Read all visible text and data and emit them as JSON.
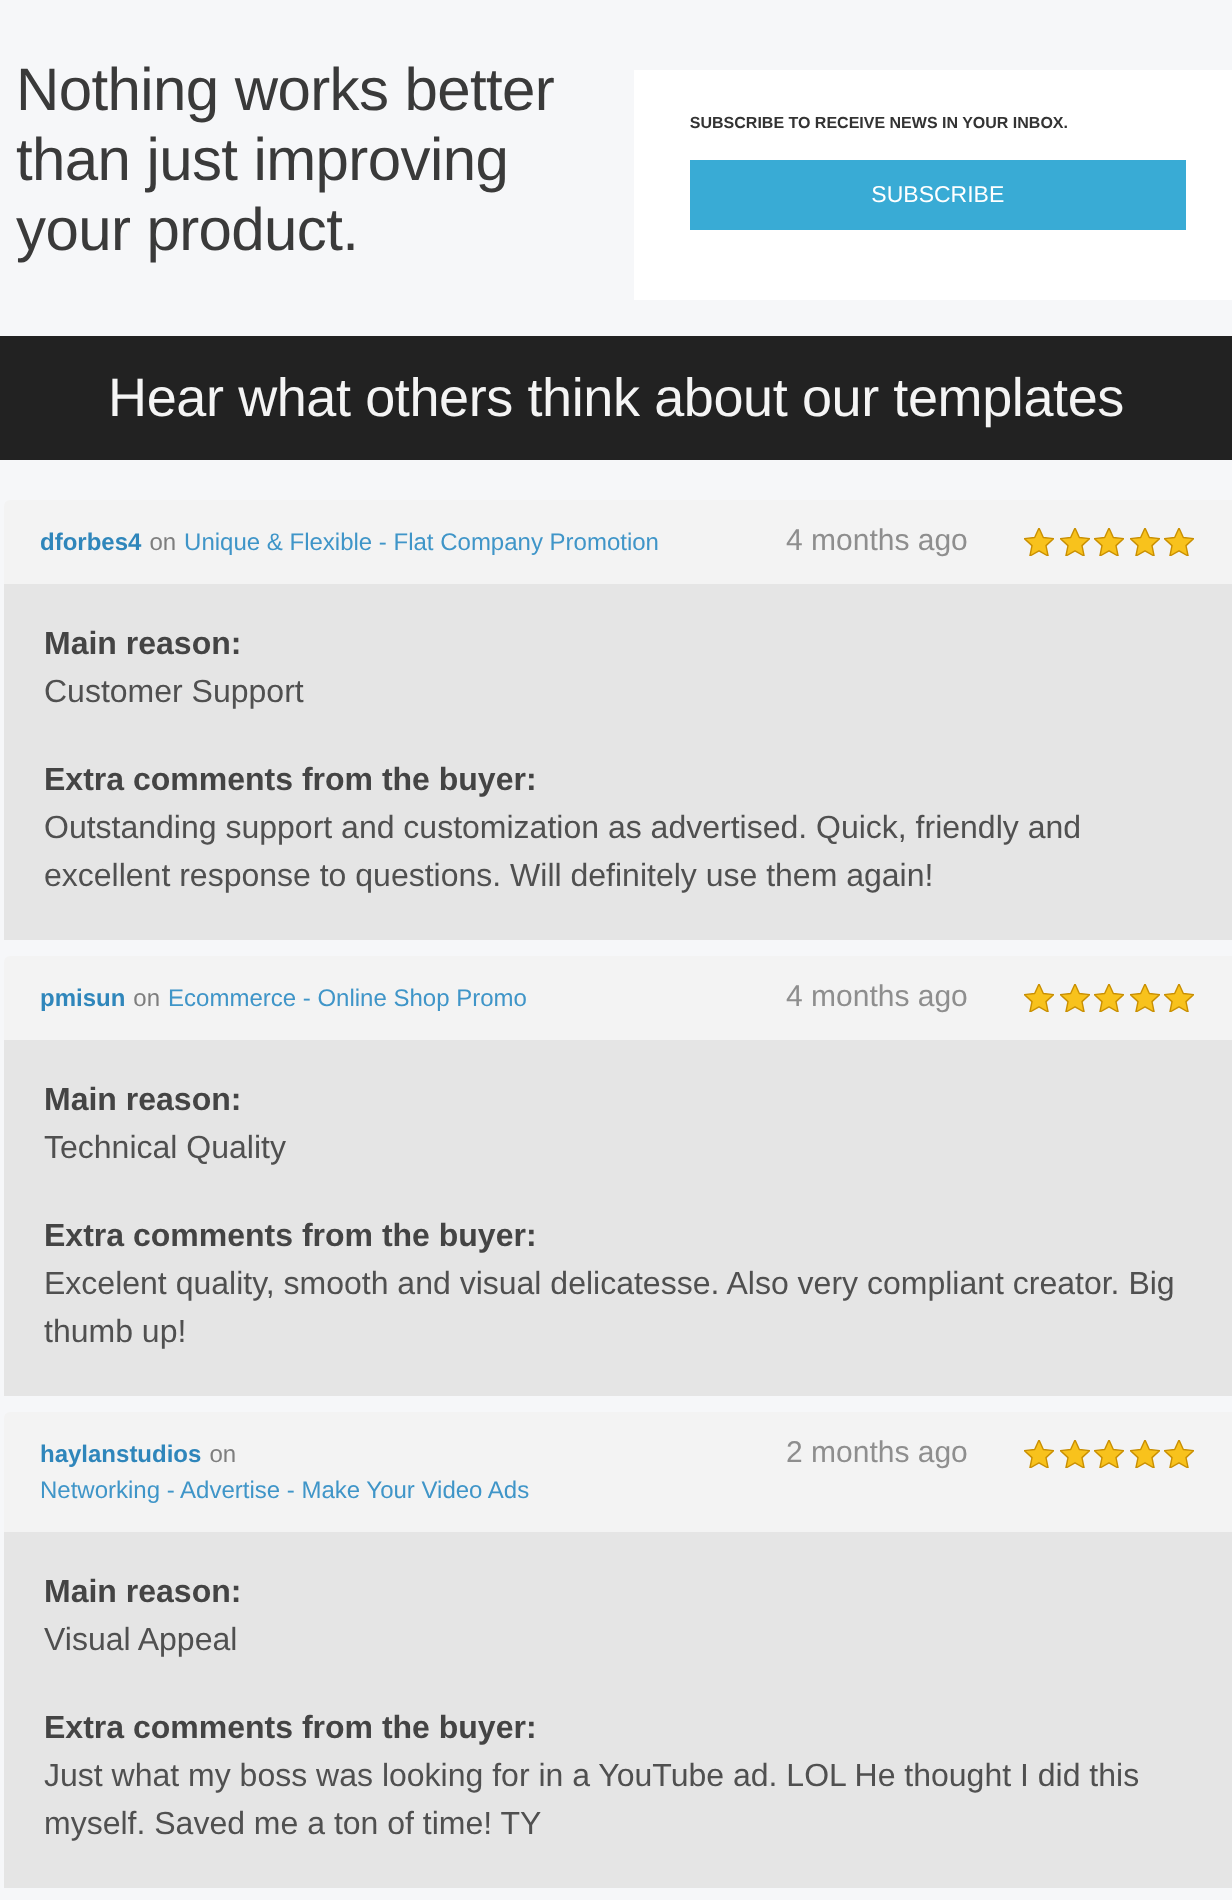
{
  "hero": {
    "headline": "Nothing works better than just improving your product.",
    "subscribe_prompt": "SUBSCRIBE TO RECEIVE NEWS IN YOUR INBOX.",
    "subscribe_button": "SUBSCRIBE"
  },
  "banner": "Hear what others think about our templates",
  "reviews": [
    {
      "user": "dforbes4",
      "preposition": "on",
      "product": "Unique & Flexible - Flat Company Promotion",
      "time": "4 months ago",
      "stars": 5,
      "reason_label": "Main reason:",
      "reason": "Customer Support",
      "comments_label": "Extra comments from the buyer:",
      "comments": "Outstanding support and customization as advertised. Quick, friendly and excellent response to questions. Will definitely use them again!"
    },
    {
      "user": "pmisun",
      "preposition": "on",
      "product": "Ecommerce - Online Shop Promo",
      "time": "4 months ago",
      "stars": 5,
      "reason_label": "Main reason:",
      "reason": "Technical Quality",
      "comments_label": "Extra comments from the buyer:",
      "comments": "Excelent quality, smooth and visual delicatesse. Also very compliant creator. Big thumb up!"
    },
    {
      "user": "haylanstudios",
      "preposition": "on",
      "product": "Networking - Advertise - Make Your Video Ads",
      "time": "2 months ago",
      "stars": 5,
      "reason_label": "Main reason:",
      "reason": "Visual Appeal",
      "comments_label": "Extra comments from the buyer:",
      "comments": "Just what my boss was looking for in a YouTube ad. LOL He thought I did this myself. Saved me a ton of time! TY"
    }
  ]
}
